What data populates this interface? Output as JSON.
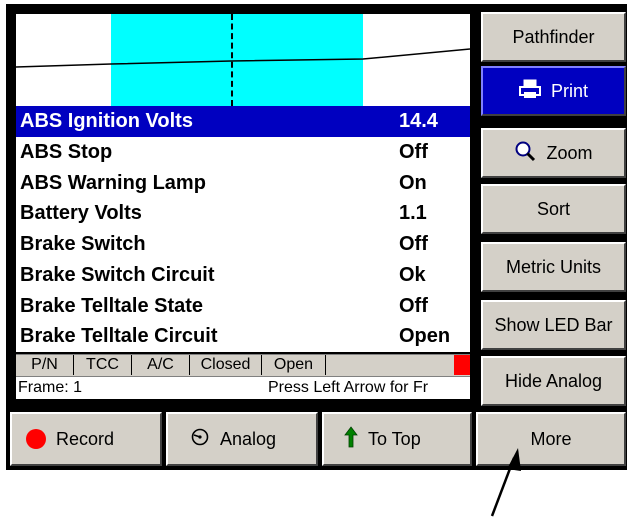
{
  "params": [
    {
      "name": "ABS Ignition Volts",
      "value": "14.4",
      "selected": true
    },
    {
      "name": "ABS Stop",
      "value": "Off"
    },
    {
      "name": "ABS Warning Lamp",
      "value": "On"
    },
    {
      "name": "Battery Volts",
      "value": "1.1"
    },
    {
      "name": "Brake Switch",
      "value": "Off"
    },
    {
      "name": "Brake Switch Circuit",
      "value": "Ok"
    },
    {
      "name": "Brake Telltale State",
      "value": "Off"
    },
    {
      "name": "Brake Telltale Circuit",
      "value": "Open"
    }
  ],
  "status_cells": [
    "P/N",
    "TCC",
    "A/C",
    "Closed",
    "Open"
  ],
  "frame_text": "Frame: 1",
  "hint_text": "Press Left Arrow for Fr",
  "side_buttons": {
    "pathfinder": "Pathfinder",
    "print": "Print",
    "zoom": "Zoom",
    "sort": "Sort",
    "metric_units": "Metric Units",
    "show_led_bar": "Show LED Bar",
    "hide_analog": "Hide Analog"
  },
  "bottom_buttons": {
    "record": "Record",
    "analog": "Analog",
    "to_top": "To Top",
    "more": "More"
  },
  "colors": {
    "selection": "#0000c0",
    "graph_band": "#00ffff",
    "record": "#ff0000",
    "to_top_arrow": "#008000"
  },
  "icons": [
    "printer-icon",
    "magnifier-icon",
    "record-icon",
    "analog-gauge-icon",
    "up-arrow-icon"
  ]
}
